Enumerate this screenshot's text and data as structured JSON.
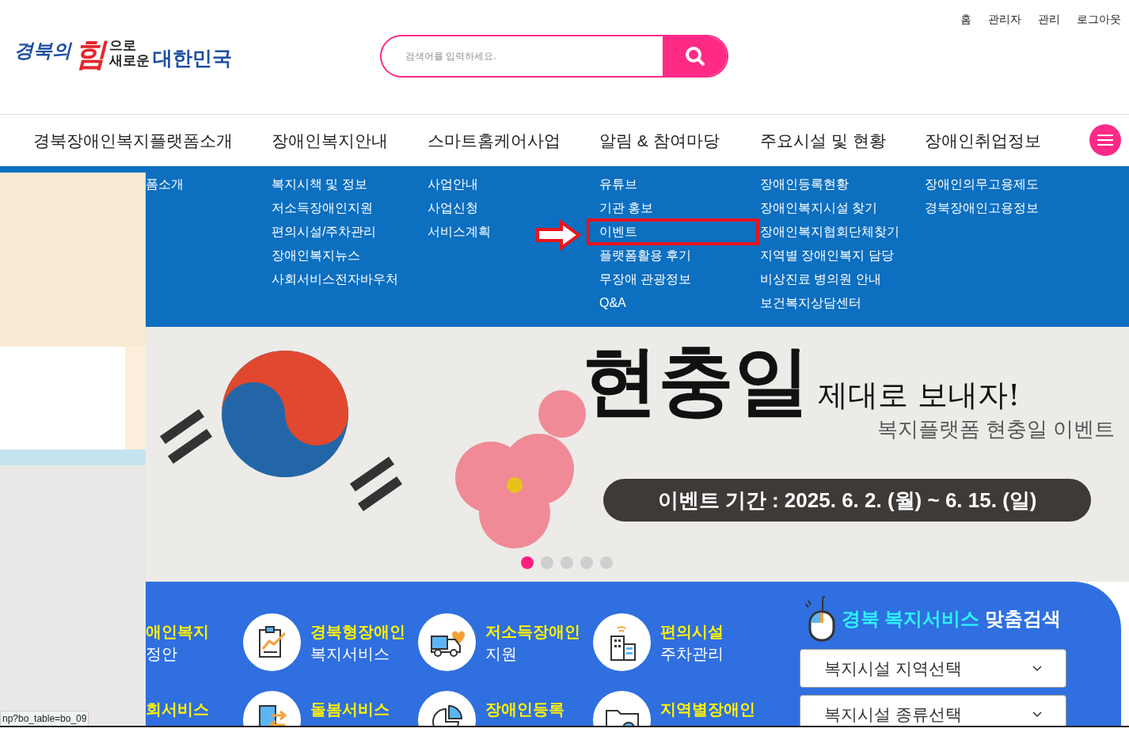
{
  "top_links": [
    "홈",
    "관리자",
    "관리",
    "로그아웃"
  ],
  "logo": {
    "script": "경북의",
    "big": "힘",
    "small_1": "으로",
    "small_2": "새로운",
    "country": "대한민국"
  },
  "search": {
    "placeholder": "검색어를 입력하세요."
  },
  "nav": [
    {
      "label": "경북장애인복지플랫폼소개",
      "items": [
        {
          "label": "폼소개",
          "highlighted": false
        }
      ]
    },
    {
      "label": "장애인복지안내",
      "items": [
        {
          "label": "복지시책 및 정보",
          "highlighted": false
        },
        {
          "label": "저소득장애인지원",
          "highlighted": false
        },
        {
          "label": "편의시설/주차관리",
          "highlighted": false
        },
        {
          "label": "장애인복지뉴스",
          "highlighted": false
        },
        {
          "label": "사회서비스전자바우처",
          "highlighted": false
        }
      ]
    },
    {
      "label": "스마트홈케어사업",
      "items": [
        {
          "label": "사업안내",
          "highlighted": false
        },
        {
          "label": "사업신청",
          "highlighted": false
        },
        {
          "label": "서비스계획",
          "highlighted": false
        }
      ]
    },
    {
      "label": "알림 & 참여마당",
      "items": [
        {
          "label": "유튜브",
          "highlighted": false
        },
        {
          "label": "기관 홍보",
          "highlighted": false
        },
        {
          "label": "이벤트",
          "highlighted": true
        },
        {
          "label": "플랫폼활용 후기",
          "highlighted": false
        },
        {
          "label": "무장애 관광정보",
          "highlighted": false
        },
        {
          "label": "Q&A",
          "highlighted": false
        }
      ]
    },
    {
      "label": "주요시설 및 현황",
      "items": [
        {
          "label": "장애인등록현황",
          "highlighted": false
        },
        {
          "label": "장애인복지시설 찾기",
          "highlighted": false
        },
        {
          "label": "장애인복지협회단체찾기",
          "highlighted": false
        },
        {
          "label": "지역별 장애인복지 담당",
          "highlighted": false
        },
        {
          "label": "비상진료 병의원 안내",
          "highlighted": false
        },
        {
          "label": "보건복지상담센터",
          "highlighted": false
        }
      ]
    },
    {
      "label": "장애인취업정보",
      "items": [
        {
          "label": "장애인의무고용제도",
          "highlighted": false
        },
        {
          "label": "경북장애인고용정보",
          "highlighted": false
        }
      ]
    }
  ],
  "banner": {
    "headline": "현충일",
    "tagline": "제대로 보내자!",
    "subtitle": "복지플랫폼 현충일 이벤트",
    "period": "이벤트 기간 : 2025. 6. 2. (월) ~ 6. 15. (일)"
  },
  "slider_dots": [
    {
      "selected": true
    },
    {
      "selected": false
    },
    {
      "selected": false
    },
    {
      "selected": false
    },
    {
      "selected": false
    }
  ],
  "services": [
    {
      "kind": "hidden",
      "title": "애인복지",
      "subtitle": "정안"
    },
    {
      "kind": "chart",
      "title": "경북형장애인",
      "subtitle": "복지서비스"
    },
    {
      "kind": "truck",
      "title": "저소득장애인",
      "subtitle": "지원"
    },
    {
      "kind": "building",
      "title": "편의시설",
      "subtitle": "주차관리"
    },
    {
      "kind": "hidden",
      "title": "회서비스"
    },
    {
      "kind": "phone",
      "title": "돌봄서비스"
    },
    {
      "kind": "pie",
      "title": "장애인등록"
    },
    {
      "kind": "folder",
      "title": "지역별장애인"
    }
  ],
  "custom_search": {
    "title_highlight": "경북 복지서비스",
    "title_rest": "맞춤검색",
    "selects": [
      "복지시설 지역선택",
      "복지시설 종류선택"
    ]
  },
  "status_url": "np?bo_table=bo_09"
}
